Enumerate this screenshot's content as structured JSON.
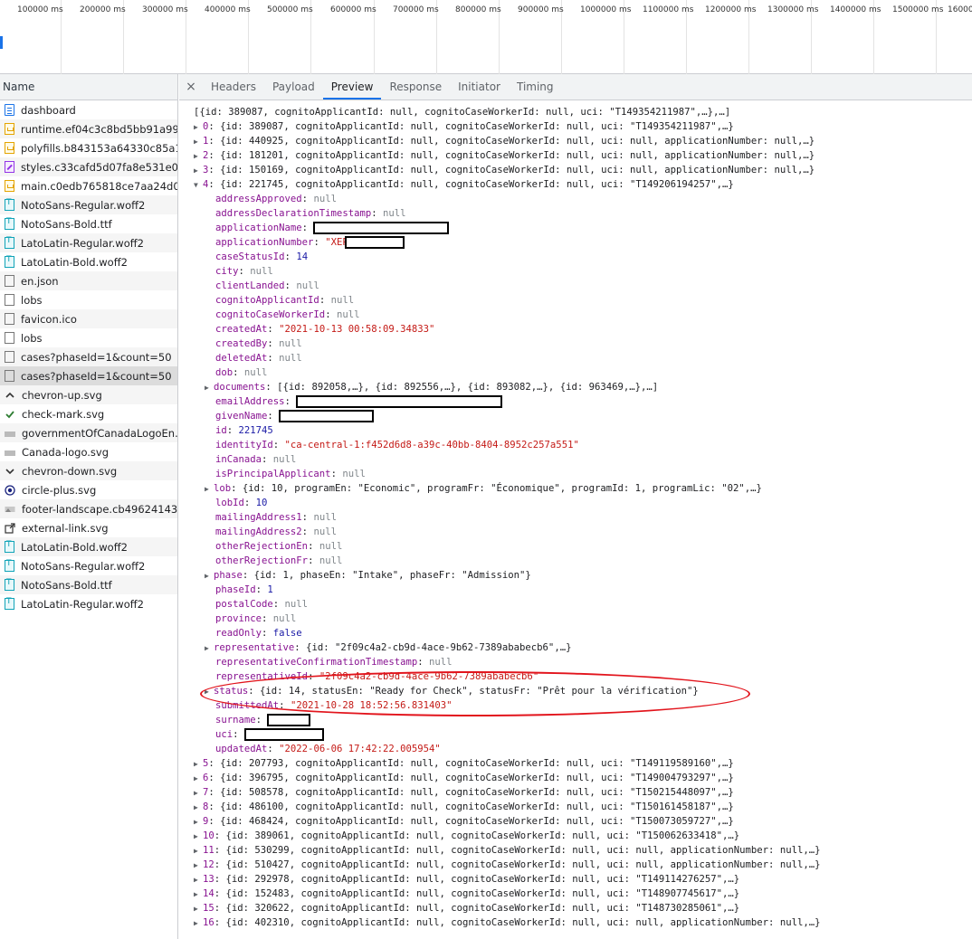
{
  "timeline": {
    "ticks": [
      "100000 ms",
      "200000 ms",
      "300000 ms",
      "400000 ms",
      "500000 ms",
      "600000 ms",
      "700000 ms",
      "800000 ms",
      "900000 ms",
      "1000000 ms",
      "1100000 ms",
      "1200000 ms",
      "1300000 ms",
      "1400000 ms",
      "1500000 ms",
      "16000"
    ]
  },
  "name_panel": {
    "header": "Name",
    "rows": [
      {
        "icon": "document-icon",
        "name": "dashboard"
      },
      {
        "icon": "js-file-icon",
        "name": "runtime.ef04c3c8bd5bb91a99..."
      },
      {
        "icon": "js-file-icon",
        "name": "polyfills.b843153a64330c85a1..."
      },
      {
        "icon": "css-file-icon",
        "name": "styles.c33cafd5d07fa8e531e0...."
      },
      {
        "icon": "js-file-icon",
        "name": "main.c0edb765818ce7aa24d0.js"
      },
      {
        "icon": "font-file-icon",
        "name": "NotoSans-Regular.woff2"
      },
      {
        "icon": "font-file-icon",
        "name": "NotoSans-Bold.ttf"
      },
      {
        "icon": "font-file-icon",
        "name": "LatoLatin-Regular.woff2"
      },
      {
        "icon": "font-file-icon",
        "name": "LatoLatin-Bold.woff2"
      },
      {
        "icon": "generic-file-icon",
        "name": "en.json"
      },
      {
        "icon": "generic-file-icon",
        "name": "lobs"
      },
      {
        "icon": "generic-file-icon",
        "name": "favicon.ico"
      },
      {
        "icon": "generic-file-icon",
        "name": "lobs"
      },
      {
        "icon": "generic-file-icon",
        "name": "cases?phaseId=1&count=50"
      },
      {
        "icon": "generic-file-icon",
        "name": "cases?phaseId=1&count=50"
      },
      {
        "icon": "chevron-up-icon",
        "name": "chevron-up.svg"
      },
      {
        "icon": "check-mark-icon",
        "name": "check-mark.svg"
      },
      {
        "icon": "flag-banner-icon",
        "name": "governmentOfCanadaLogoEn...."
      },
      {
        "icon": "flag-banner-icon",
        "name": "Canada-logo.svg"
      },
      {
        "icon": "chevron-down-icon",
        "name": "chevron-down.svg"
      },
      {
        "icon": "circle-plus-icon",
        "name": "circle-plus.svg"
      },
      {
        "icon": "landscape-image-icon",
        "name": "footer-landscape.cb49624143..."
      },
      {
        "icon": "external-link-icon",
        "name": "external-link.svg"
      },
      {
        "icon": "font-file-icon",
        "name": "LatoLatin-Bold.woff2"
      },
      {
        "icon": "font-file-icon",
        "name": "NotoSans-Regular.woff2"
      },
      {
        "icon": "font-file-icon",
        "name": "NotoSans-Bold.ttf"
      },
      {
        "icon": "font-file-icon",
        "name": "LatoLatin-Regular.woff2"
      }
    ]
  },
  "preview": {
    "close": "×",
    "tabs": [
      "Headers",
      "Payload",
      "Preview",
      "Response",
      "Initiator",
      "Timing"
    ],
    "active_tab": "Preview",
    "root_line": "[{id: 389087, cognitoApplicantId: null, cognitoCaseWorkerId: null, uci: \"T149354211987\",…},…]",
    "top_items": [
      {
        "idx": "0",
        "text": "{id: 389087, cognitoApplicantId: null, cognitoCaseWorkerId: null, uci: \"T149354211987\",…}"
      },
      {
        "idx": "1",
        "text": "{id: 440925, cognitoApplicantId: null, cognitoCaseWorkerId: null, uci: null, applicationNumber: null,…}"
      },
      {
        "idx": "2",
        "text": "{id: 181201, cognitoApplicantId: null, cognitoCaseWorkerId: null, uci: null, applicationNumber: null,…}"
      },
      {
        "idx": "3",
        "text": "{id: 150169, cognitoApplicantId: null, cognitoCaseWorkerId: null, uci: null, applicationNumber: null,…}"
      },
      {
        "idx": "4",
        "text": "{id: 221745, cognitoApplicantId: null, cognitoCaseWorkerId: null, uci: \"T149206194257\",…}"
      }
    ],
    "item4_fields": [
      {
        "key": "addressApproved",
        "val": "null",
        "type": "nul"
      },
      {
        "key": "addressDeclarationTimestamp",
        "val": "null",
        "type": "nul"
      },
      {
        "key": "applicationName",
        "val": "",
        "type": "redacted"
      },
      {
        "key": "applicationNumber",
        "val": "\"XEP",
        "type": "str-redacted"
      },
      {
        "key": "caseStatusId",
        "val": "14",
        "type": "num"
      },
      {
        "key": "city",
        "val": "null",
        "type": "nul"
      },
      {
        "key": "clientLanded",
        "val": "null",
        "type": "nul"
      },
      {
        "key": "cognitoApplicantId",
        "val": "null",
        "type": "nul"
      },
      {
        "key": "cognitoCaseWorkerId",
        "val": "null",
        "type": "nul"
      },
      {
        "key": "createdAt",
        "val": "\"2021-10-13 00:58:09.34833\"",
        "type": "str"
      },
      {
        "key": "createdBy",
        "val": "null",
        "type": "nul"
      },
      {
        "key": "deletedAt",
        "val": "null",
        "type": "nul"
      },
      {
        "key": "dob",
        "val": "null",
        "type": "nul"
      },
      {
        "key": "documents",
        "val": "[{id: 892058,…}, {id: 892556,…}, {id: 893082,…}, {id: 963469,…},…]",
        "type": "obj"
      },
      {
        "key": "emailAddress",
        "val": "",
        "type": "redacted"
      },
      {
        "key": "givenName",
        "val": "",
        "type": "redacted"
      },
      {
        "key": "id",
        "val": "221745",
        "type": "num"
      },
      {
        "key": "identityId",
        "val": "\"ca-central-1:f452d6d8-a39c-40bb-8404-8952c257a551\"",
        "type": "str"
      },
      {
        "key": "inCanada",
        "val": "null",
        "type": "nul"
      },
      {
        "key": "isPrincipalApplicant",
        "val": "null",
        "type": "nul"
      },
      {
        "key": "lob",
        "val": "{id: 10, programEn: \"Economic\", programFr: \"Économique\", programId: 1, programLic: \"02\",…}",
        "type": "obj"
      },
      {
        "key": "lobId",
        "val": "10",
        "type": "num"
      },
      {
        "key": "mailingAddress1",
        "val": "null",
        "type": "nul"
      },
      {
        "key": "mailingAddress2",
        "val": "null",
        "type": "nul"
      },
      {
        "key": "otherRejectionEn",
        "val": "null",
        "type": "nul"
      },
      {
        "key": "otherRejectionFr",
        "val": "null",
        "type": "nul"
      },
      {
        "key": "phase",
        "val": "{id: 1, phaseEn: \"Intake\", phaseFr: \"Admission\"}",
        "type": "obj"
      },
      {
        "key": "phaseId",
        "val": "1",
        "type": "num"
      },
      {
        "key": "postalCode",
        "val": "null",
        "type": "nul"
      },
      {
        "key": "province",
        "val": "null",
        "type": "nul"
      },
      {
        "key": "readOnly",
        "val": "false",
        "type": "kw"
      },
      {
        "key": "representative",
        "val": "{id: \"2f09c4a2-cb9d-4ace-9b62-7389ababecb6\",…}",
        "type": "obj"
      },
      {
        "key": "representativeConfirmationTimestamp",
        "val": "null",
        "type": "nul"
      },
      {
        "key": "representativeId",
        "val": "\"2f09c4a2-cb9d-4ace-9b62-7389ababecb6\"",
        "type": "str"
      },
      {
        "key": "status",
        "val": "{id: 14, statusEn: \"Ready for Check\", statusFr: \"Prêt pour la vérification\"}",
        "type": "obj"
      },
      {
        "key": "submittedAt",
        "val": "\"2021-10-28 18:52:56.831403\"",
        "type": "str"
      },
      {
        "key": "surname",
        "val": "",
        "type": "redacted"
      },
      {
        "key": "uci",
        "val": "",
        "type": "redacted"
      },
      {
        "key": "updatedAt",
        "val": "\"2022-06-06 17:42:22.005954\"",
        "type": "str"
      }
    ],
    "bottom_items": [
      {
        "idx": "5",
        "text": "{id: 207793, cognitoApplicantId: null, cognitoCaseWorkerId: null, uci: \"T149119589160\",…}"
      },
      {
        "idx": "6",
        "text": "{id: 396795, cognitoApplicantId: null, cognitoCaseWorkerId: null, uci: \"T149004793297\",…}"
      },
      {
        "idx": "7",
        "text": "{id: 508578, cognitoApplicantId: null, cognitoCaseWorkerId: null, uci: \"T150215448097\",…}"
      },
      {
        "idx": "8",
        "text": "{id: 486100, cognitoApplicantId: null, cognitoCaseWorkerId: null, uci: \"T150161458187\",…}"
      },
      {
        "idx": "9",
        "text": "{id: 468424, cognitoApplicantId: null, cognitoCaseWorkerId: null, uci: \"T150073059727\",…}"
      },
      {
        "idx": "10",
        "text": "{id: 389061, cognitoApplicantId: null, cognitoCaseWorkerId: null, uci: \"T150062633418\",…}"
      },
      {
        "idx": "11",
        "text": "{id: 530299, cognitoApplicantId: null, cognitoCaseWorkerId: null, uci: null, applicationNumber: null,…}"
      },
      {
        "idx": "12",
        "text": "{id: 510427, cognitoApplicantId: null, cognitoCaseWorkerId: null, uci: null, applicationNumber: null,…}"
      },
      {
        "idx": "13",
        "text": "{id: 292978, cognitoApplicantId: null, cognitoCaseWorkerId: null, uci: \"T149114276257\",…}"
      },
      {
        "idx": "14",
        "text": "{id: 152483, cognitoApplicantId: null, cognitoCaseWorkerId: null, uci: \"T148907745617\",…}"
      },
      {
        "idx": "15",
        "text": "{id: 320622, cognitoApplicantId: null, cognitoCaseWorkerId: null, uci: \"T148730285061\",…}"
      },
      {
        "idx": "16",
        "text": "{id: 402310, cognitoApplicantId: null, cognitoCaseWorkerId: null, uci: null, applicationNumber: null,…}"
      }
    ],
    "annotation_color": "#e2141c"
  }
}
